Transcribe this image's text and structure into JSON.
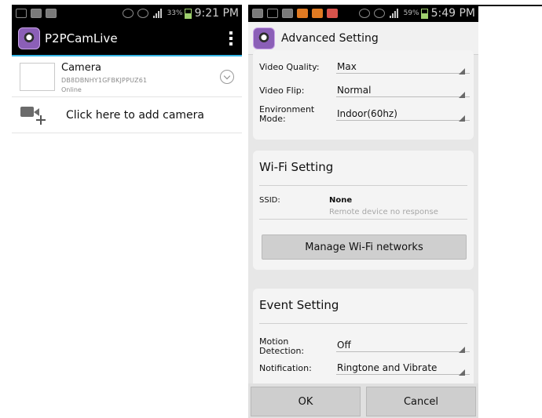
{
  "left_screen": {
    "status_bar": {
      "battery": "33%",
      "time": "9:21 PM"
    },
    "app_title": "P2PCamLive",
    "camera": {
      "name": "Camera",
      "id": "DB8DBNHY1GFBKJPPUZ61",
      "status": "Online"
    },
    "add_camera_label": "Click here to add camera"
  },
  "right_screen": {
    "status_bar": {
      "battery": "59%",
      "time": "5:49 PM"
    },
    "title": "Advanced Setting",
    "video": {
      "quality_label": "Video Quality:",
      "quality_value": "Max",
      "flip_label": "Video Flip:",
      "flip_value": "Normal",
      "environment_label_line1": "Environment",
      "environment_label_line2": "Mode:",
      "environment_value": "Indoor(60hz)"
    },
    "wifi": {
      "title": "Wi-Fi Setting",
      "ssid_label": "SSID:",
      "ssid_value": "None",
      "ssid_note": "Remote device no response",
      "manage_button": "Manage Wi-Fi networks"
    },
    "event": {
      "title": "Event Setting",
      "motion_label_line1": "Motion",
      "motion_label_line2": "Detection:",
      "motion_value": "Off",
      "notification_label": "Notification:",
      "notification_value": "Ringtone and Vibrate"
    },
    "footer": {
      "ok": "OK",
      "cancel": "Cancel"
    }
  }
}
